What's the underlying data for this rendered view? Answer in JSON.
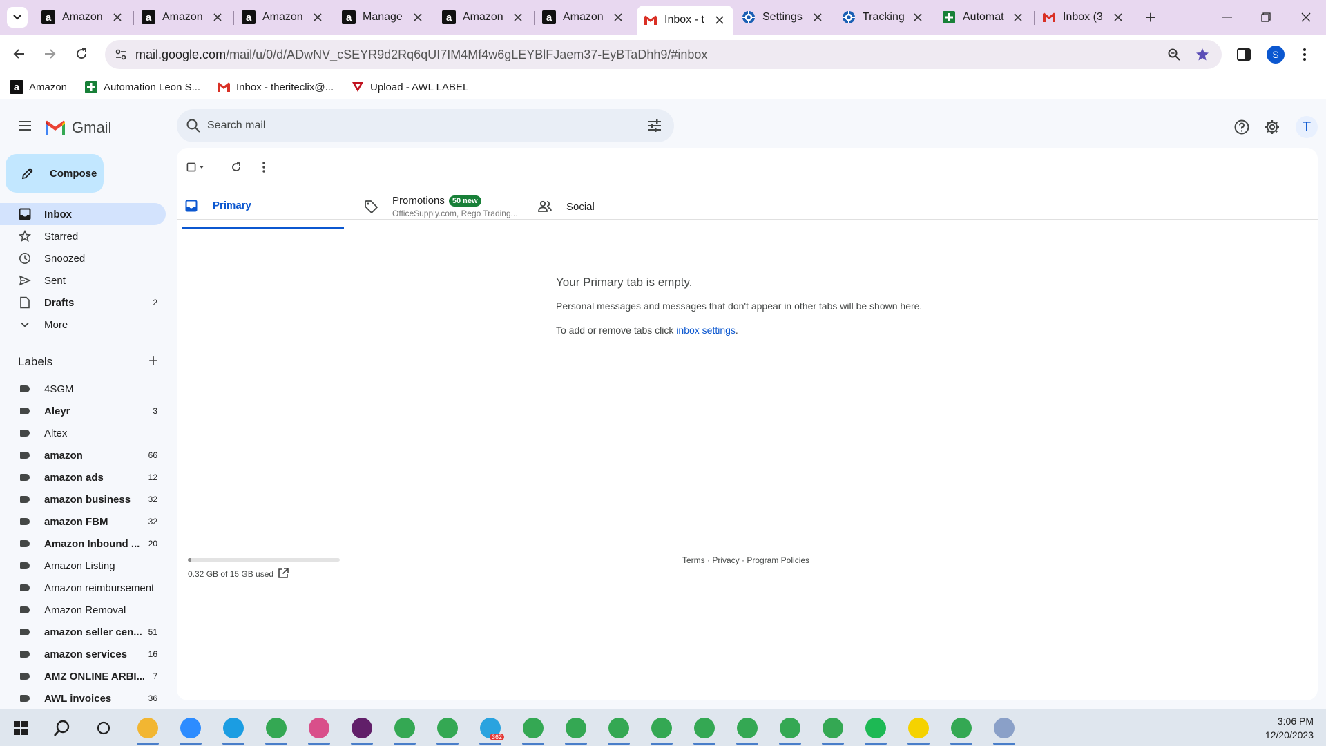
{
  "browser": {
    "tabs": [
      {
        "title": "Amazon",
        "favicon": "amazon-icon",
        "active": false
      },
      {
        "title": "Amazon",
        "favicon": "amazon-icon",
        "active": false
      },
      {
        "title": "Amazon",
        "favicon": "amazon-icon",
        "active": false
      },
      {
        "title": "Manage",
        "favicon": "amazon-icon",
        "active": false
      },
      {
        "title": "Amazon",
        "favicon": "amazon-icon",
        "active": false
      },
      {
        "title": "Amazon",
        "favicon": "amazon-icon",
        "active": false
      },
      {
        "title": "Inbox - t",
        "favicon": "gmail-icon",
        "active": true
      },
      {
        "title": "Settings",
        "favicon": "settings-app-icon",
        "active": false
      },
      {
        "title": "Tracking",
        "favicon": "tracking-app-icon",
        "active": false
      },
      {
        "title": "Automat",
        "favicon": "sheets-icon",
        "active": false
      },
      {
        "title": "Inbox (3",
        "favicon": "gmail-icon",
        "active": false
      }
    ],
    "url": {
      "host": "mail.google.com",
      "path": "/mail/u/0/d/ADwNV_cSEYR9d2Rq6qUI7IM4Mf4w6gLEYBlFJaem37-EyBTaDhh9/#inbox"
    },
    "profile_initial": "S",
    "bookmarks": [
      {
        "label": "Amazon",
        "icon": "amazon-icon"
      },
      {
        "label": "Automation Leon S...",
        "icon": "sheets-icon"
      },
      {
        "label": "Inbox - theriteclix@...",
        "icon": "gmail-icon"
      },
      {
        "label": "Upload - AWL LABEL",
        "icon": "awl-icon"
      }
    ]
  },
  "gmail": {
    "brand": "Gmail",
    "search_placeholder": "Search mail",
    "avatar_initial": "T",
    "compose_label": "Compose",
    "nav": [
      {
        "label": "Inbox",
        "icon": "inbox-icon",
        "count": "",
        "active": true,
        "bold": true
      },
      {
        "label": "Starred",
        "icon": "star-icon",
        "count": "",
        "active": false,
        "bold": false
      },
      {
        "label": "Snoozed",
        "icon": "clock-icon",
        "count": "",
        "active": false,
        "bold": false
      },
      {
        "label": "Sent",
        "icon": "send-icon",
        "count": "",
        "active": false,
        "bold": false
      },
      {
        "label": "Drafts",
        "icon": "draft-icon",
        "count": "2",
        "active": false,
        "bold": true
      },
      {
        "label": "More",
        "icon": "chevron-down-icon",
        "count": "",
        "active": false,
        "bold": false
      }
    ],
    "labels_heading": "Labels",
    "labels": [
      {
        "label": "4SGM",
        "count": "",
        "bold": false
      },
      {
        "label": "Aleyr",
        "count": "3",
        "bold": true
      },
      {
        "label": "Altex",
        "count": "",
        "bold": false
      },
      {
        "label": "amazon",
        "count": "66",
        "bold": true
      },
      {
        "label": "amazon ads",
        "count": "12",
        "bold": true
      },
      {
        "label": "amazon business",
        "count": "32",
        "bold": true
      },
      {
        "label": "amazon FBM",
        "count": "32",
        "bold": true
      },
      {
        "label": "Amazon Inbound ...",
        "count": "20",
        "bold": true
      },
      {
        "label": "Amazon Listing",
        "count": "",
        "bold": false
      },
      {
        "label": "Amazon reimbursement",
        "count": "",
        "bold": false
      },
      {
        "label": "Amazon Removal",
        "count": "",
        "bold": false
      },
      {
        "label": "amazon seller cen...",
        "count": "51",
        "bold": true
      },
      {
        "label": "amazon services",
        "count": "16",
        "bold": true
      },
      {
        "label": "AMZ ONLINE ARBI...",
        "count": "7",
        "bold": true
      },
      {
        "label": "AWL invoices",
        "count": "36",
        "bold": true
      }
    ],
    "tabs": {
      "primary": "Primary",
      "promotions": "Promotions",
      "promotions_badge": "50 new",
      "promotions_sub": "OfficeSupply.com, Rego Trading...",
      "social": "Social"
    },
    "empty": {
      "title": "Your Primary tab is empty.",
      "line1": "Personal messages and messages that don't appear in other tabs will be shown here.",
      "line2_prefix": "To add or remove tabs click ",
      "line2_link": "inbox settings",
      "line2_suffix": "."
    },
    "storage": {
      "text": "0.32 GB of 15 GB used",
      "fraction": 0.021
    },
    "footer": "Terms · Privacy · Program Policies"
  },
  "taskbar": {
    "apps": [
      {
        "name": "windows-start-icon",
        "color": "#1f1f1f"
      },
      {
        "name": "search-icon",
        "color": "#1f1f1f"
      },
      {
        "name": "task-view-icon",
        "color": "#1f1f1f"
      },
      {
        "name": "file-explorer-icon",
        "color": "#f2b632"
      },
      {
        "name": "zoom-icon",
        "color": "#2d8cff"
      },
      {
        "name": "edge-icon",
        "color": "#1b9de2"
      },
      {
        "name": "chrome-icon",
        "color": "#34a853"
      },
      {
        "name": "paint-icon",
        "color": "#d94f8a"
      },
      {
        "name": "slack-icon",
        "color": "#611f69"
      },
      {
        "name": "chrome-icon",
        "color": "#34a853"
      },
      {
        "name": "chrome-icon",
        "color": "#34a853"
      },
      {
        "name": "telegram-icon",
        "color": "#2aa3df"
      },
      {
        "name": "chrome-icon",
        "color": "#34a853"
      },
      {
        "name": "chrome-icon",
        "color": "#34a853"
      },
      {
        "name": "chrome-icon",
        "color": "#34a853"
      },
      {
        "name": "chrome-icon",
        "color": "#34a853"
      },
      {
        "name": "chrome-icon",
        "color": "#34a853"
      },
      {
        "name": "chrome-icon",
        "color": "#34a853"
      },
      {
        "name": "chrome-icon",
        "color": "#34a853"
      },
      {
        "name": "chrome-icon",
        "color": "#34a853"
      },
      {
        "name": "spotify-icon",
        "color": "#1db954"
      },
      {
        "name": "sticky-notes-icon",
        "color": "#f5d200"
      },
      {
        "name": "chrome-icon",
        "color": "#34a853"
      },
      {
        "name": "paint-brush-icon",
        "color": "#8aa0c8"
      }
    ],
    "telegram_badge": "362",
    "time": "3:06 PM",
    "date": "12/20/2023"
  },
  "colors": {
    "accent": "#0b57d0",
    "compose_bg": "#c2e7ff",
    "active_nav": "#d3e3fd",
    "badge_green": "#188038"
  }
}
